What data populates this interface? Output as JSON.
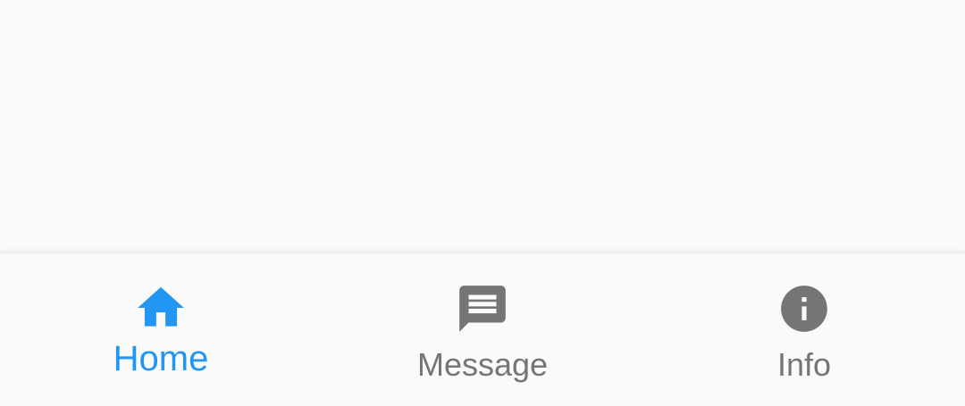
{
  "nav": {
    "items": [
      {
        "label": "Home",
        "icon": "home-icon",
        "active": true
      },
      {
        "label": "Message",
        "icon": "message-icon",
        "active": false
      },
      {
        "label": "Info",
        "icon": "info-icon",
        "active": false
      }
    ]
  },
  "colors": {
    "active": "#2196f3",
    "inactive": "#757575",
    "background": "#fafafa"
  }
}
